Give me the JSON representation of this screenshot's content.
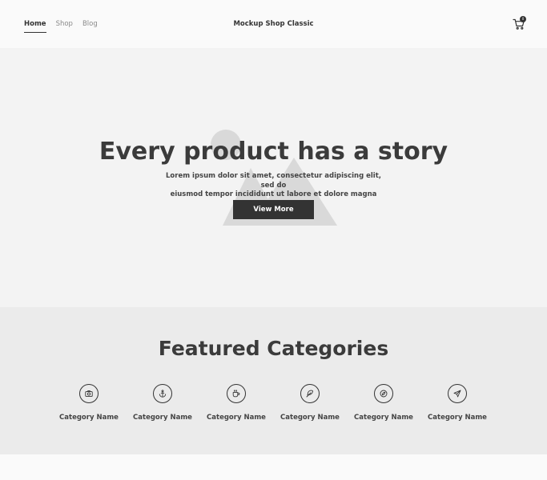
{
  "header": {
    "nav": [
      {
        "label": "Home",
        "active": true
      },
      {
        "label": "Shop",
        "active": false
      },
      {
        "label": "Blog",
        "active": false
      }
    ],
    "brand": "Mockup Shop Classic",
    "cart": {
      "icon": "cart-icon",
      "count": "0"
    }
  },
  "hero": {
    "title": "Every product has a story",
    "subtitle_line1": "Lorem ipsum dolor sit amet, consectetur adipiscing elit, sed do",
    "subtitle_line2": "eiusmod tempor incididunt ut labore et dolore magna aliqua.",
    "button_label": "View More",
    "background_icon": "image-placeholder-icon"
  },
  "featured": {
    "title": "Featured Categories",
    "categories": [
      {
        "label": "Category Name",
        "icon": "camera-icon"
      },
      {
        "label": "Category Name",
        "icon": "anchor-icon"
      },
      {
        "label": "Category Name",
        "icon": "coffee-icon"
      },
      {
        "label": "Category Name",
        "icon": "feather-icon"
      },
      {
        "label": "Category Name",
        "icon": "compass-icon"
      },
      {
        "label": "Category Name",
        "icon": "send-icon"
      }
    ]
  },
  "colors": {
    "text": "#3b3b3b",
    "button": "#333333",
    "hero_bg": "#f3f3f3",
    "featured_bg": "#ebebeb",
    "page_bg": "#fafafa"
  }
}
